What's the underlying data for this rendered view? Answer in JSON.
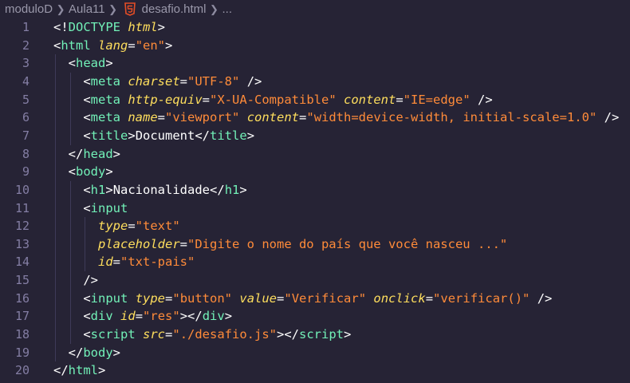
{
  "breadcrumb": {
    "items": [
      "moduloD",
      "Aula11",
      "desafio.html",
      "..."
    ],
    "separator": ">"
  },
  "editor": {
    "language": "html",
    "line_numbers": [
      "1",
      "2",
      "3",
      "4",
      "5",
      "6",
      "7",
      "8",
      "9",
      "10",
      "11",
      "12",
      "13",
      "14",
      "15",
      "16",
      "17",
      "18",
      "19",
      "20"
    ],
    "lines": [
      [
        [
          "p",
          "<!"
        ],
        [
          "t",
          "DOCTYPE"
        ],
        [
          "x",
          " "
        ],
        [
          "dt",
          "html"
        ],
        [
          "p",
          ">"
        ]
      ],
      [
        [
          "p",
          "<"
        ],
        [
          "t",
          "html"
        ],
        [
          "x",
          " "
        ],
        [
          "a",
          "lang"
        ],
        [
          "p",
          "="
        ],
        [
          "s",
          "\"en\""
        ],
        [
          "p",
          ">"
        ]
      ],
      [
        [
          "x",
          "  "
        ],
        [
          "p",
          "<"
        ],
        [
          "t",
          "head"
        ],
        [
          "p",
          ">"
        ]
      ],
      [
        [
          "x",
          "    "
        ],
        [
          "p",
          "<"
        ],
        [
          "t",
          "meta"
        ],
        [
          "x",
          " "
        ],
        [
          "a",
          "charset"
        ],
        [
          "p",
          "="
        ],
        [
          "s",
          "\"UTF-8\""
        ],
        [
          "x",
          " "
        ],
        [
          "p",
          "/>"
        ]
      ],
      [
        [
          "x",
          "    "
        ],
        [
          "p",
          "<"
        ],
        [
          "t",
          "meta"
        ],
        [
          "x",
          " "
        ],
        [
          "a",
          "http-equiv"
        ],
        [
          "p",
          "="
        ],
        [
          "s",
          "\"X-UA-Compatible\""
        ],
        [
          "x",
          " "
        ],
        [
          "a",
          "content"
        ],
        [
          "p",
          "="
        ],
        [
          "s",
          "\"IE=edge\""
        ],
        [
          "x",
          " "
        ],
        [
          "p",
          "/>"
        ]
      ],
      [
        [
          "x",
          "    "
        ],
        [
          "p",
          "<"
        ],
        [
          "t",
          "meta"
        ],
        [
          "x",
          " "
        ],
        [
          "a",
          "name"
        ],
        [
          "p",
          "="
        ],
        [
          "s",
          "\"viewport\""
        ],
        [
          "x",
          " "
        ],
        [
          "a",
          "content"
        ],
        [
          "p",
          "="
        ],
        [
          "s",
          "\"width=device-width, initial-scale=1.0\""
        ],
        [
          "x",
          " "
        ],
        [
          "p",
          "/>"
        ]
      ],
      [
        [
          "x",
          "    "
        ],
        [
          "p",
          "<"
        ],
        [
          "t",
          "title"
        ],
        [
          "p",
          ">"
        ],
        [
          "x",
          "Document"
        ],
        [
          "p",
          "</"
        ],
        [
          "t",
          "title"
        ],
        [
          "p",
          ">"
        ]
      ],
      [
        [
          "x",
          "  "
        ],
        [
          "p",
          "</"
        ],
        [
          "t",
          "head"
        ],
        [
          "p",
          ">"
        ]
      ],
      [
        [
          "x",
          "  "
        ],
        [
          "p",
          "<"
        ],
        [
          "t",
          "body"
        ],
        [
          "p",
          ">"
        ]
      ],
      [
        [
          "x",
          "    "
        ],
        [
          "p",
          "<"
        ],
        [
          "t",
          "h1"
        ],
        [
          "p",
          ">"
        ],
        [
          "x",
          "Nacionalidade"
        ],
        [
          "p",
          "</"
        ],
        [
          "t",
          "h1"
        ],
        [
          "p",
          ">"
        ]
      ],
      [
        [
          "x",
          "    "
        ],
        [
          "p",
          "<"
        ],
        [
          "t",
          "input"
        ]
      ],
      [
        [
          "x",
          "      "
        ],
        [
          "a",
          "type"
        ],
        [
          "p",
          "="
        ],
        [
          "s",
          "\"text\""
        ]
      ],
      [
        [
          "x",
          "      "
        ],
        [
          "a",
          "placeholder"
        ],
        [
          "p",
          "="
        ],
        [
          "s",
          "\"Digite o nome do país que você nasceu ...\""
        ]
      ],
      [
        [
          "x",
          "      "
        ],
        [
          "a",
          "id"
        ],
        [
          "p",
          "="
        ],
        [
          "s",
          "\"txt-pais\""
        ]
      ],
      [
        [
          "x",
          "    "
        ],
        [
          "p",
          "/>"
        ]
      ],
      [
        [
          "x",
          "    "
        ],
        [
          "p",
          "<"
        ],
        [
          "t",
          "input"
        ],
        [
          "x",
          " "
        ],
        [
          "a",
          "type"
        ],
        [
          "p",
          "="
        ],
        [
          "s",
          "\"button\""
        ],
        [
          "x",
          " "
        ],
        [
          "a",
          "value"
        ],
        [
          "p",
          "="
        ],
        [
          "s",
          "\"Verificar\""
        ],
        [
          "x",
          " "
        ],
        [
          "a",
          "onclick"
        ],
        [
          "p",
          "="
        ],
        [
          "s",
          "\"verificar()\""
        ],
        [
          "x",
          " "
        ],
        [
          "p",
          "/>"
        ]
      ],
      [
        [
          "x",
          "    "
        ],
        [
          "p",
          "<"
        ],
        [
          "t",
          "div"
        ],
        [
          "x",
          " "
        ],
        [
          "a",
          "id"
        ],
        [
          "p",
          "="
        ],
        [
          "s",
          "\"res\""
        ],
        [
          "p",
          "></"
        ],
        [
          "t",
          "div"
        ],
        [
          "p",
          ">"
        ]
      ],
      [
        [
          "x",
          "    "
        ],
        [
          "p",
          "<"
        ],
        [
          "t",
          "script"
        ],
        [
          "x",
          " "
        ],
        [
          "a",
          "src"
        ],
        [
          "p",
          "="
        ],
        [
          "s",
          "\"./desafio.js\""
        ],
        [
          "p",
          "></"
        ],
        [
          "t",
          "script"
        ],
        [
          "p",
          ">"
        ]
      ],
      [
        [
          "x",
          "  "
        ],
        [
          "p",
          "</"
        ],
        [
          "t",
          "body"
        ],
        [
          "p",
          ">"
        ]
      ],
      [
        [
          "p",
          "</"
        ],
        [
          "t",
          "html"
        ],
        [
          "p",
          ">"
        ]
      ]
    ]
  },
  "colors": {
    "background": "#262335",
    "tag": "#72f1b8",
    "attribute": "#fede5d",
    "string": "#ff8b39",
    "line_number": "#847ea4",
    "html5_icon": "#e44d26"
  }
}
